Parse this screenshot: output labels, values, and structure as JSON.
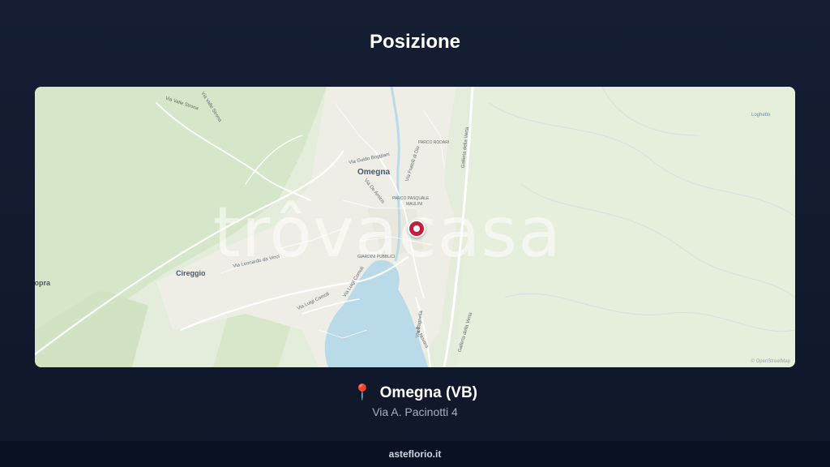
{
  "page": {
    "title": "Posizione"
  },
  "map": {
    "watermark": "trôvacasa",
    "place_labels": {
      "omegna": "Omegna",
      "cireggio": "Cireggio",
      "ropra": "ropra",
      "parco_rodari": "PARCO RODARI",
      "parco_pasquale": "PARCO PASQUALE",
      "maulini": "MAULINI",
      "giardini": "GIARDINI PUBBLICI",
      "loghetto": "Loghetto"
    },
    "street_labels": {
      "valle_strona": "Via Valle Strona",
      "strona": "Via Valle Strona",
      "guido_boggiani": "Via Guido Boggiani",
      "fratelli_di_dio": "Via Fratelli di Dio",
      "de_amicis": "Via De Amicis",
      "leonardo_da_vinci": "Via Leonardo da Vinci",
      "comoli_1": "Via Luigi Comoli",
      "comoli_2": "Via Luigi Comoli",
      "galleria_verta_1": "Galleria della Verta",
      "galleria_verta_2": "Galleria della Verta",
      "bagnella": "Via Bagnella",
      "novara": "Via Novara"
    },
    "attribution": "© OpenStreetMap"
  },
  "location": {
    "pin_icon": "📍",
    "name": "Omegna (VB)",
    "address": "Via A. Pacinotti 4"
  },
  "footer": {
    "text": "asteflorio.it"
  }
}
